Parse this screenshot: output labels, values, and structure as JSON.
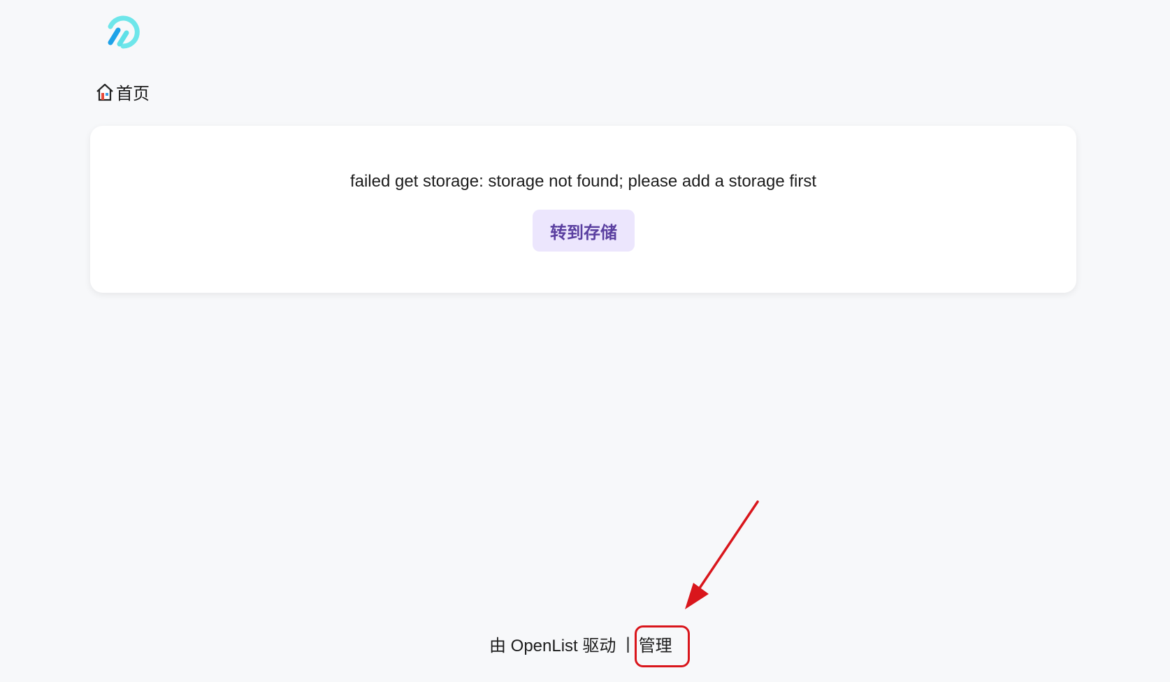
{
  "logo": {
    "icon": "openlist-logo-icon",
    "colors": [
      "#5fe0e8",
      "#1ea2e8"
    ]
  },
  "breadcrumb": {
    "icon": "home-icon",
    "label": "首页"
  },
  "error": {
    "message": "failed get storage: storage not found; please add a storage first",
    "button_label": "转到存储"
  },
  "footer": {
    "powered_by": "由 OpenList 驱动",
    "separator": "|",
    "manage_label": "管理"
  },
  "annotation": {
    "color": "#d9161c",
    "icon": "red-arrow-icon"
  },
  "colors": {
    "background": "#f7f8fa",
    "card": "#ffffff",
    "button_bg": "#ece6fd",
    "button_text": "#5a3fa0"
  }
}
